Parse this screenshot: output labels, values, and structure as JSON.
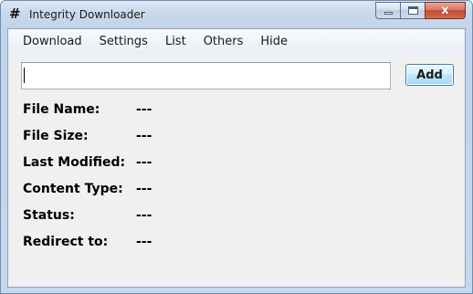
{
  "window": {
    "icon_glyph": "#",
    "title": "Integrity Downloader",
    "close_glyph": "x",
    "close_color": "#c7462b"
  },
  "menu": {
    "items": [
      {
        "label": "Download"
      },
      {
        "label": "Settings"
      },
      {
        "label": "List"
      },
      {
        "label": "Others"
      },
      {
        "label": "Hide"
      }
    ]
  },
  "url_input": {
    "value": "",
    "placeholder": ""
  },
  "add_button": {
    "label": "Add"
  },
  "info": {
    "rows": [
      {
        "label": "File Name:",
        "value": "---"
      },
      {
        "label": "File Size:",
        "value": "---"
      },
      {
        "label": "Last Modified:",
        "value": "---"
      },
      {
        "label": "Content Type:",
        "value": "---"
      },
      {
        "label": "Status:",
        "value": "---"
      },
      {
        "label": "Redirect to:",
        "value": "---"
      }
    ]
  }
}
